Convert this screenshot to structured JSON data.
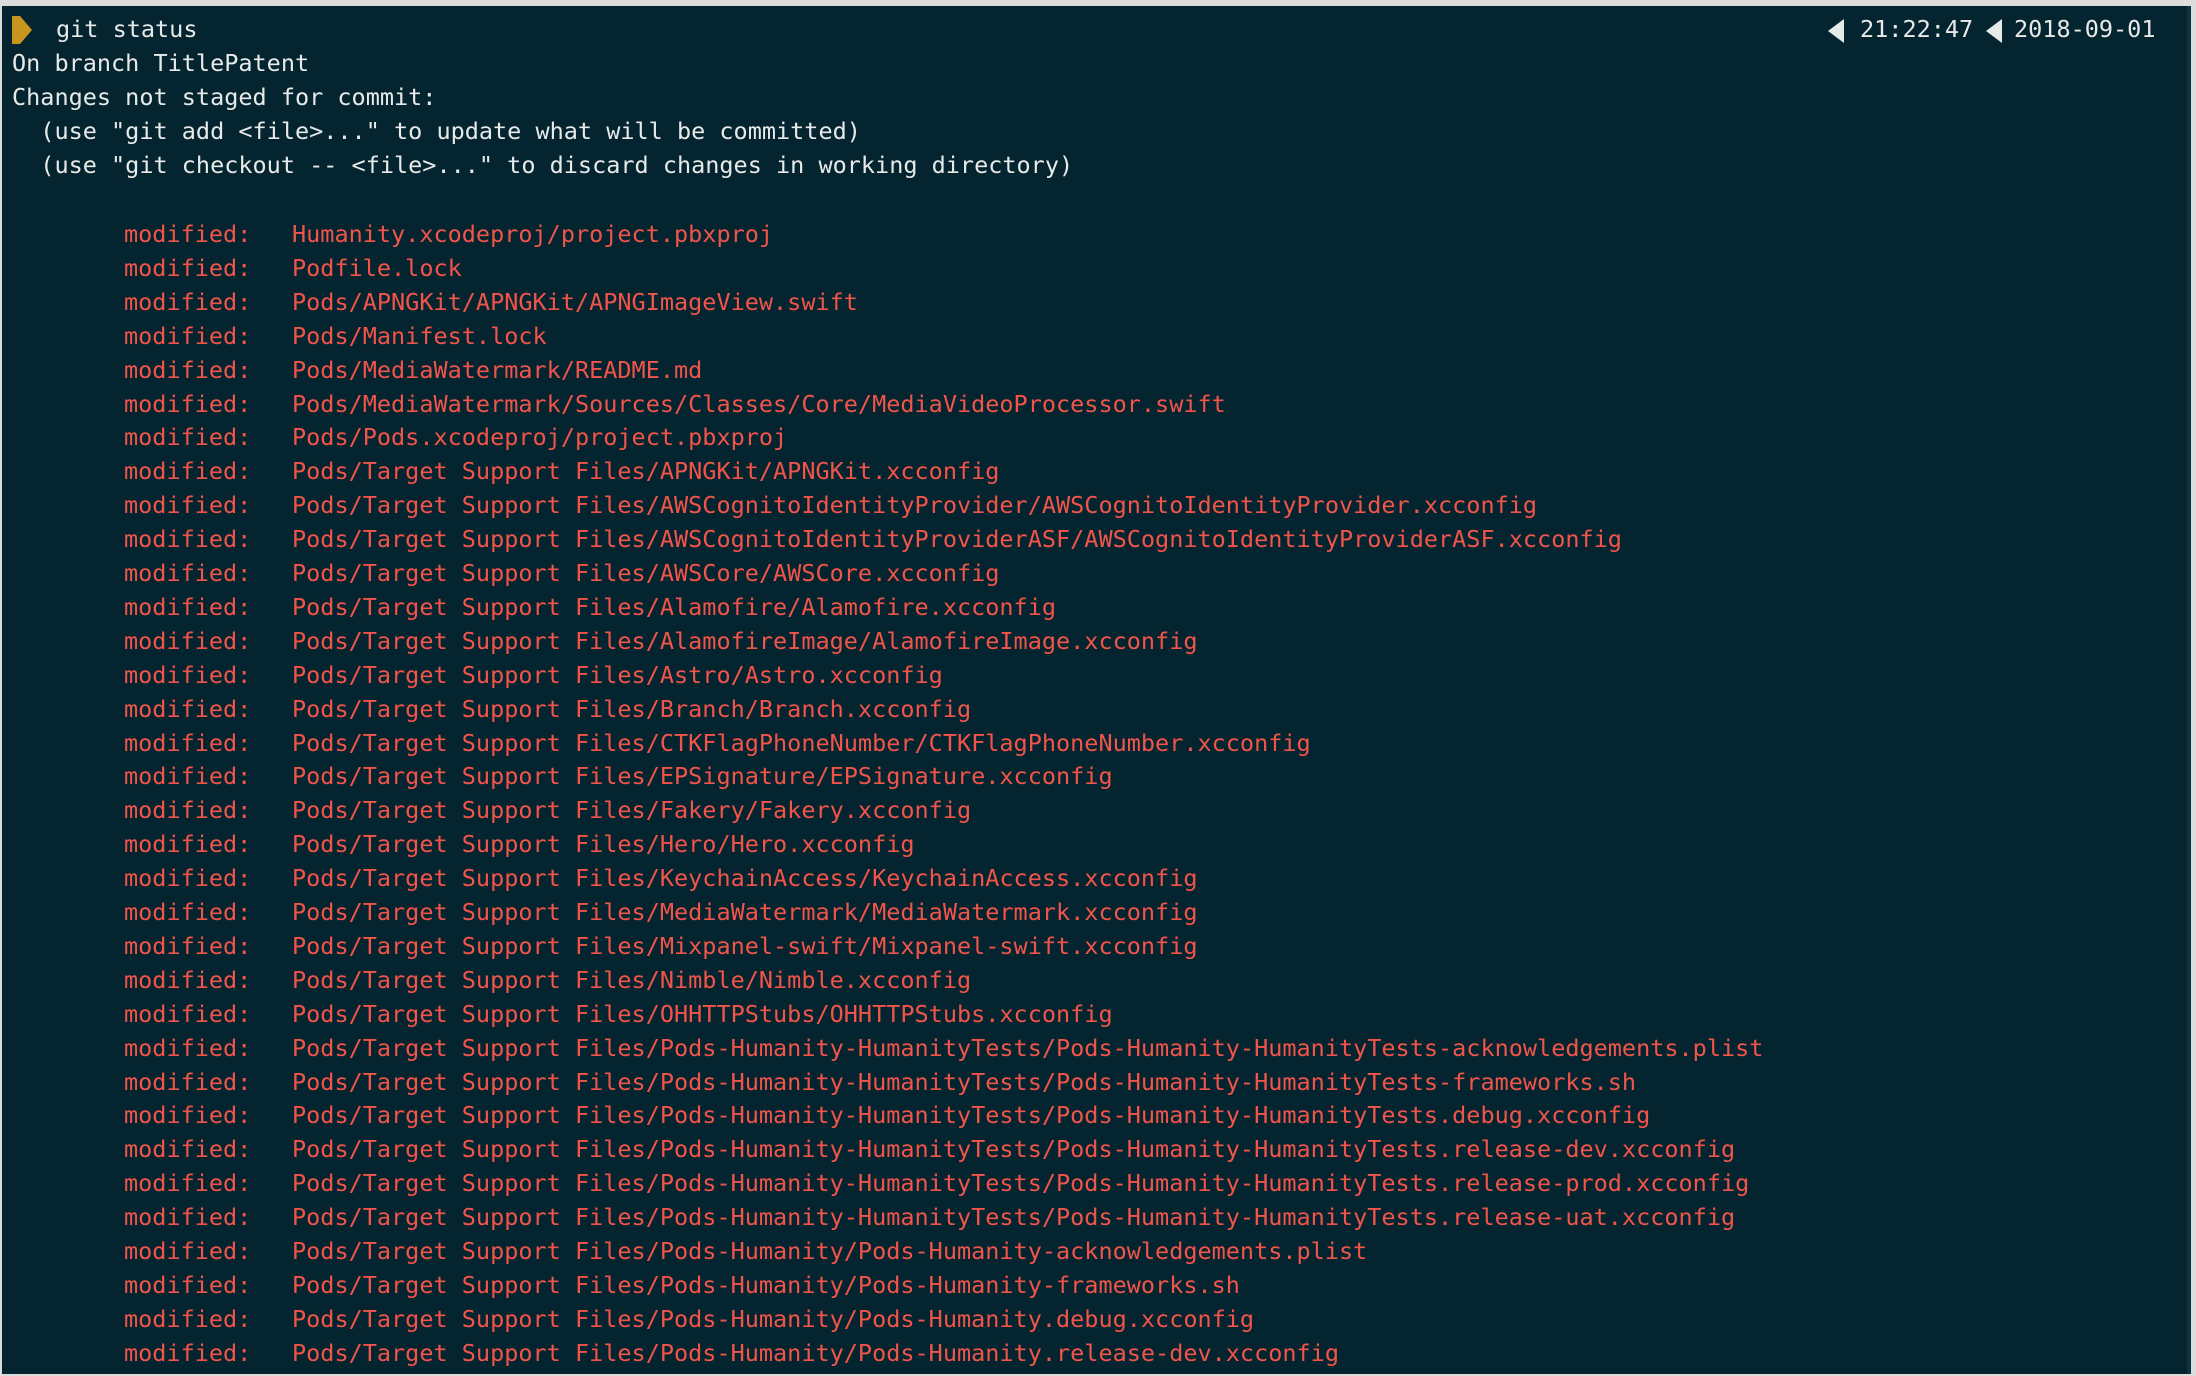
{
  "prompt": {
    "command": "git status",
    "time": "21:22:47",
    "date": "2018-09-01"
  },
  "status": {
    "branch_line": "On branch TitlePatent",
    "changes_header": "Changes not staged for commit:",
    "hint_add": "  (use \"git add <file>...\" to update what will be committed)",
    "hint_checkout": "  (use \"git checkout -- <file>...\" to discard changes in working directory)"
  },
  "colors": {
    "background": "#04252f",
    "text": "#e8eaea",
    "modified": "#f2544a",
    "prompt_segment": "#c8961e"
  },
  "modified_label": "modified:",
  "modified_files": [
    "Humanity.xcodeproj/project.pbxproj",
    "Podfile.lock",
    "Pods/APNGKit/APNGKit/APNGImageView.swift",
    "Pods/Manifest.lock",
    "Pods/MediaWatermark/README.md",
    "Pods/MediaWatermark/Sources/Classes/Core/MediaVideoProcessor.swift",
    "Pods/Pods.xcodeproj/project.pbxproj",
    "Pods/Target Support Files/APNGKit/APNGKit.xcconfig",
    "Pods/Target Support Files/AWSCognitoIdentityProvider/AWSCognitoIdentityProvider.xcconfig",
    "Pods/Target Support Files/AWSCognitoIdentityProviderASF/AWSCognitoIdentityProviderASF.xcconfig",
    "Pods/Target Support Files/AWSCore/AWSCore.xcconfig",
    "Pods/Target Support Files/Alamofire/Alamofire.xcconfig",
    "Pods/Target Support Files/AlamofireImage/AlamofireImage.xcconfig",
    "Pods/Target Support Files/Astro/Astro.xcconfig",
    "Pods/Target Support Files/Branch/Branch.xcconfig",
    "Pods/Target Support Files/CTKFlagPhoneNumber/CTKFlagPhoneNumber.xcconfig",
    "Pods/Target Support Files/EPSignature/EPSignature.xcconfig",
    "Pods/Target Support Files/Fakery/Fakery.xcconfig",
    "Pods/Target Support Files/Hero/Hero.xcconfig",
    "Pods/Target Support Files/KeychainAccess/KeychainAccess.xcconfig",
    "Pods/Target Support Files/MediaWatermark/MediaWatermark.xcconfig",
    "Pods/Target Support Files/Mixpanel-swift/Mixpanel-swift.xcconfig",
    "Pods/Target Support Files/Nimble/Nimble.xcconfig",
    "Pods/Target Support Files/OHHTTPStubs/OHHTTPStubs.xcconfig",
    "Pods/Target Support Files/Pods-Humanity-HumanityTests/Pods-Humanity-HumanityTests-acknowledgements.plist",
    "Pods/Target Support Files/Pods-Humanity-HumanityTests/Pods-Humanity-HumanityTests-frameworks.sh",
    "Pods/Target Support Files/Pods-Humanity-HumanityTests/Pods-Humanity-HumanityTests.debug.xcconfig",
    "Pods/Target Support Files/Pods-Humanity-HumanityTests/Pods-Humanity-HumanityTests.release-dev.xcconfig",
    "Pods/Target Support Files/Pods-Humanity-HumanityTests/Pods-Humanity-HumanityTests.release-prod.xcconfig",
    "Pods/Target Support Files/Pods-Humanity-HumanityTests/Pods-Humanity-HumanityTests.release-uat.xcconfig",
    "Pods/Target Support Files/Pods-Humanity/Pods-Humanity-acknowledgements.plist",
    "Pods/Target Support Files/Pods-Humanity/Pods-Humanity-frameworks.sh",
    "Pods/Target Support Files/Pods-Humanity/Pods-Humanity.debug.xcconfig",
    "Pods/Target Support Files/Pods-Humanity/Pods-Humanity.release-dev.xcconfig"
  ]
}
